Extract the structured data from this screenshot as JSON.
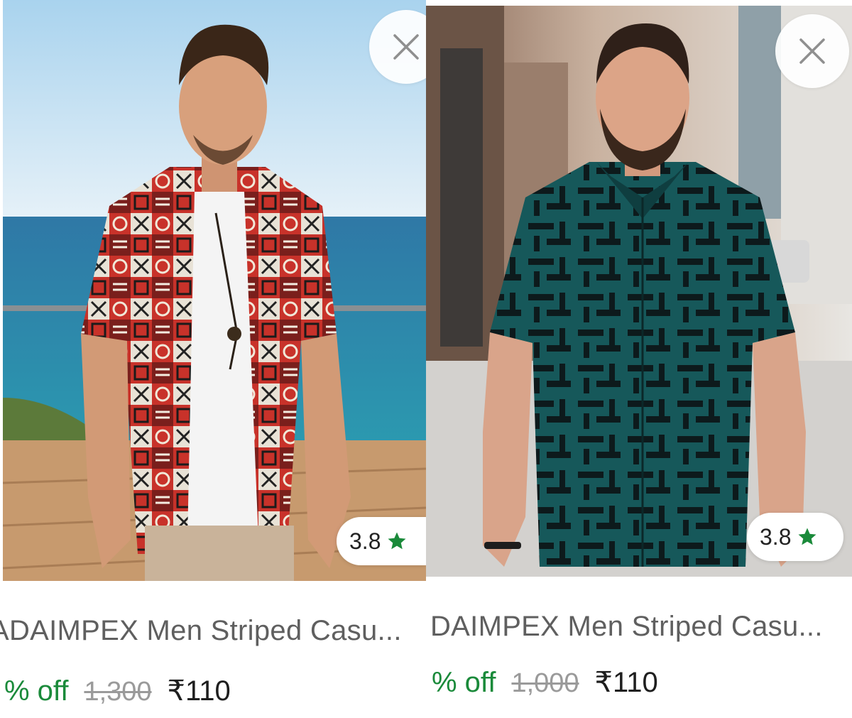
{
  "products": [
    {
      "title": "ADAIMPEX Men Striped Casu...",
      "discount": "% off",
      "mrp": "1,300",
      "price": "₹110",
      "rating": "3.8",
      "close_icon": "close-icon",
      "rating_icon": "star-icon",
      "accent": "#1a8a3a"
    },
    {
      "title": "DAIMPEX Men Striped Casu...",
      "discount": "% off",
      "mrp": "1,000",
      "price": "₹110",
      "rating": "3.8",
      "close_icon": "close-icon",
      "rating_icon": "star-icon",
      "accent": "#1a8a3a"
    }
  ]
}
